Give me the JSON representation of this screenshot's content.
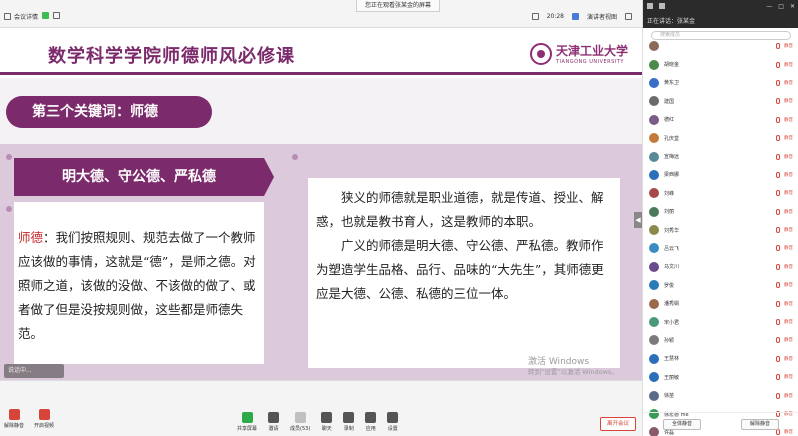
{
  "topbar": {
    "meeting_label": "会议详情",
    "banner": "您正在观看张某金的屏幕",
    "time": "20:28",
    "view_mode": "演讲者视图"
  },
  "slide": {
    "title": "数学科学学院师德师风必修课",
    "logo_cn": "天津工业大学",
    "logo_en": "TIANGONG UNIVERSITY",
    "keyword": "第三个关键词：师德",
    "card_title": "明大德、守公德、严私德",
    "left_highlight": "师德",
    "left_text": "：我们按照规则、规范去做了一个教师应该做的事情，这就是“德”，是师之德。对照师之道，该做的没做、不该做的做了、或者做了但是没按规则做，这些都是师德失范。",
    "right_p1": "狭义的师德就是职业道德，就是传道、授业、解惑，也就是教书育人，这是教师的本职。",
    "right_p2": "广义的师德是明大德、守公德、严私德。教师作为塑造学生品格、品行、品味的“大先生”，其师德更应是大德、公德、私德的三位一体。",
    "watermark_line1": "激活 Windows",
    "watermark_line2": "转到“设置”以激活 Windows。",
    "ghost_label": "说话中..."
  },
  "toolbar": {
    "unmute": "解除静音",
    "start_video": "开启视频",
    "tools": [
      "共享屏幕",
      "邀请",
      "成员(53)",
      "聊天",
      "录制",
      "应用",
      "设置"
    ],
    "leave": "离开会议"
  },
  "sidebar": {
    "speaking": "正在讲话：张某金",
    "search_placeholder": "搜索成员",
    "participants": [
      {
        "name": "",
        "color": "#8b6a5a"
      },
      {
        "name": "胡晓金",
        "color": "#4a8a4a"
      },
      {
        "name": "黄东卫",
        "color": "#3a6ec4"
      },
      {
        "name": "建国",
        "color": "#6b6b6b"
      },
      {
        "name": "德红",
        "color": "#7a5c8a"
      },
      {
        "name": "孔庆堂",
        "color": "#c47a3a"
      },
      {
        "name": "宣梅远",
        "color": "#5a8a9a"
      },
      {
        "name": "梁西娜",
        "color": "#2b6fb8"
      },
      {
        "name": "刘峰",
        "color": "#a44a4a"
      },
      {
        "name": "刘丽",
        "color": "#4a7a5a"
      },
      {
        "name": "刘秀华",
        "color": "#8a8a4a"
      },
      {
        "name": "吕云飞",
        "color": "#3a8ac4"
      },
      {
        "name": "马文川",
        "color": "#6a4a8a"
      },
      {
        "name": "罗俊",
        "color": "#2b7ab8"
      },
      {
        "name": "潘秀娟",
        "color": "#9a6a4a"
      },
      {
        "name": "宋小君",
        "color": "#4a9a7a"
      },
      {
        "name": "孙颖",
        "color": "#7a7a7a"
      },
      {
        "name": "王慧林",
        "color": "#2b6fb8"
      },
      {
        "name": "王丽敏",
        "color": "#2b6fb8"
      },
      {
        "name": "徐苗",
        "color": "#5a6a8a"
      },
      {
        "name": "徐宏德 me",
        "color": "#3a9a5a"
      },
      {
        "name": "许磊",
        "color": "#8a5a6a"
      }
    ],
    "tag": "静音",
    "mute_all": "全体静音",
    "unmute_all": "解除静音"
  }
}
